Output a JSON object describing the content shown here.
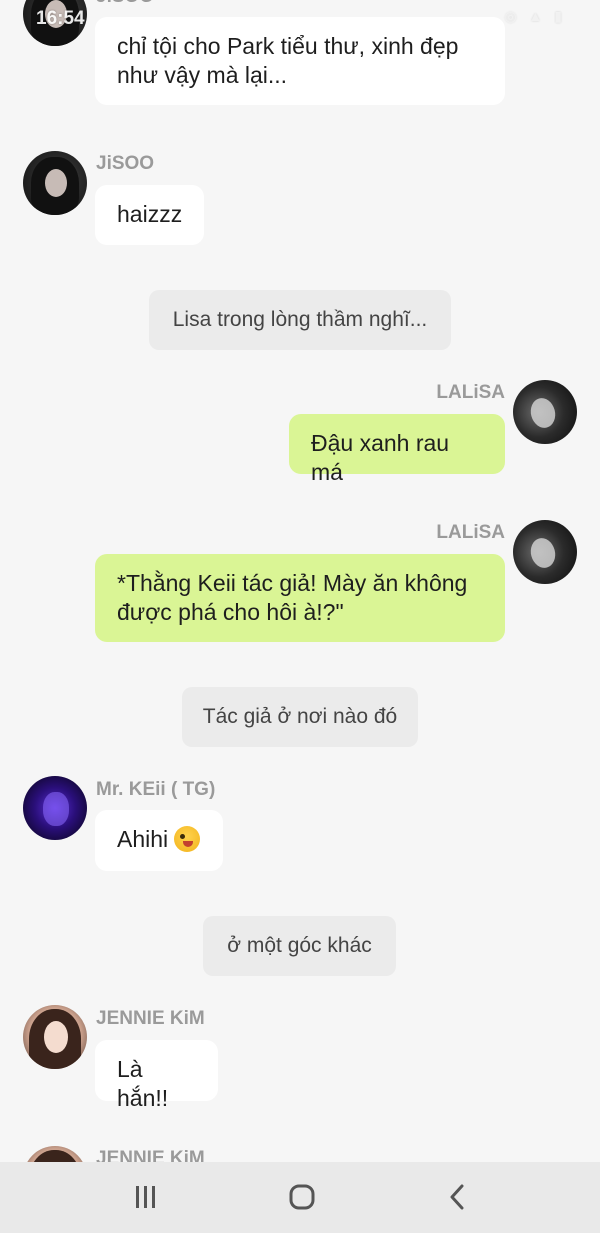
{
  "status_bar": {
    "time": "16:54",
    "icons": "wifi signal battery"
  },
  "messages": [
    {
      "type": "incoming",
      "sender": "JiSOO",
      "text": "chỉ tội cho Park tiểu thư, xinh đẹp như vậy mà lại..."
    },
    {
      "type": "incoming",
      "sender": "JiSOO",
      "text": "haizzz"
    },
    {
      "type": "system",
      "text": "Lisa trong lòng thầm nghĩ..."
    },
    {
      "type": "outgoing",
      "sender": "LALiSA",
      "text": "Đậu xanh rau má"
    },
    {
      "type": "outgoing",
      "sender": "LALiSA",
      "text": "*Thằng Keii tác giả! Mày ăn không được phá cho hôi à!?\""
    },
    {
      "type": "system",
      "text": "Tác giả ở nơi nào đó"
    },
    {
      "type": "incoming",
      "sender": "Mr. KEii ( TG)",
      "text": "Ahihi",
      "emoji": "crazy-face-emoji"
    },
    {
      "type": "system",
      "text": "ở một góc khác"
    },
    {
      "type": "incoming",
      "sender": "JENNIE KiM",
      "text": "Là hắn!!"
    },
    {
      "type": "incoming",
      "sender": "JENNIE KiM",
      "text": ""
    }
  ],
  "nav_bar": {
    "recent": "recent-apps-icon",
    "home": "home-icon",
    "back": "back-icon"
  },
  "colors": {
    "background": "#f6f6f6",
    "incoming_bubble": "#ffffff",
    "outgoing_bubble": "#daf595",
    "system_bubble": "#ebebeb",
    "sender_name": "#9a9a9a"
  }
}
